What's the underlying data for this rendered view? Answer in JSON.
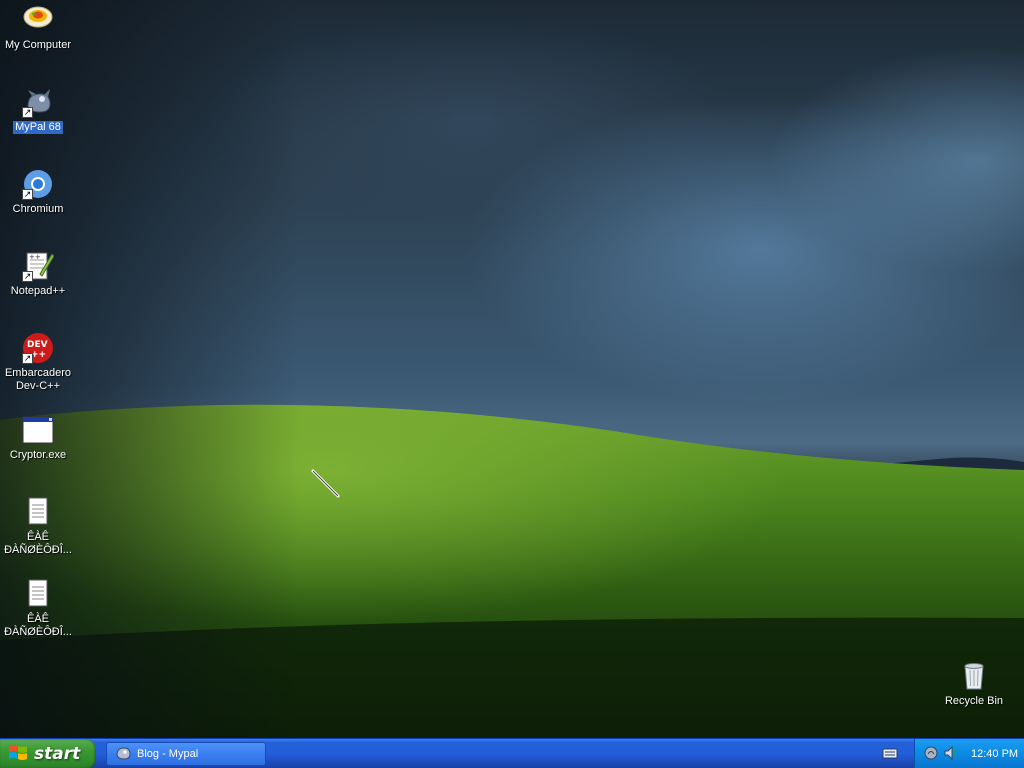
{
  "desktop": {
    "icons": [
      {
        "label": "My Computer",
        "icon": "my-computer-icon"
      },
      {
        "label": "MyPal 68",
        "icon": "mypal-icon",
        "selected": true
      },
      {
        "label": "Chromium",
        "icon": "chromium-icon"
      },
      {
        "label": "Notepad++",
        "icon": "notepadpp-icon"
      },
      {
        "label": "Embarcadero Dev-C++",
        "icon": "devcpp-icon"
      },
      {
        "label": "Cryptor.exe",
        "icon": "exe-window-icon"
      },
      {
        "label": "ÊÀÊ ÐÀÑØÈÔÐÎ...",
        "icon": "text-file-icon"
      },
      {
        "label": "ÊÀÊ ÐÀÑØÈÔÐÎ...",
        "icon": "text-file-icon"
      }
    ],
    "recycle_bin": {
      "label": "Recycle Bin",
      "icon": "recycle-bin-icon"
    }
  },
  "taskbar": {
    "start_label": "start",
    "tasks": [
      {
        "label": "Blog - Mypal",
        "icon": "mypal-icon",
        "active": true
      }
    ],
    "tray": {
      "icons": [
        "keyboard-icon",
        "network-icon",
        "volume-icon"
      ],
      "clock": "12:40 PM"
    }
  },
  "colors": {
    "taskbar_blue": "#245edb",
    "start_green": "#3c9b35",
    "tray_blue": "#0c8ae4",
    "selection_blue": "#316ac5"
  }
}
